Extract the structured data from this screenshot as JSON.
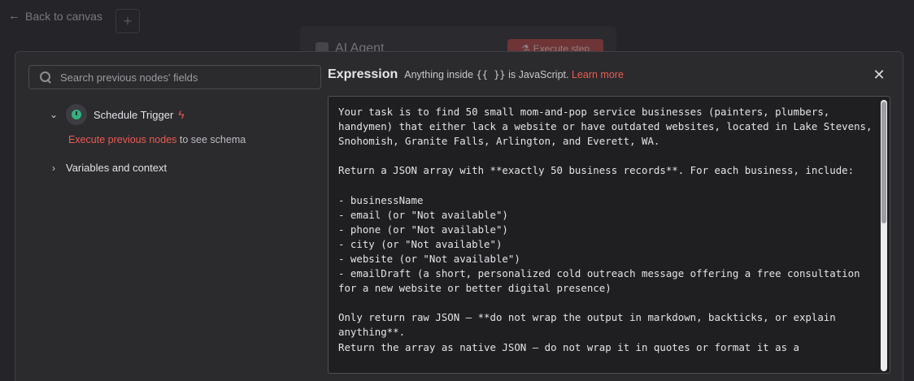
{
  "background": {
    "back_label": "Back to canvas",
    "agent_title": "AI Agent",
    "execute_step_label": "Execute step"
  },
  "search": {
    "placeholder": "Search previous nodes' fields"
  },
  "tree": {
    "node_label": "Schedule Trigger",
    "hint_link": "Execute previous nodes",
    "hint_rest": " to see schema",
    "variables_label": "Variables and context"
  },
  "expression": {
    "title": "Expression",
    "subtitle_prefix": "Anything inside",
    "subtitle_braces": "{{ }}",
    "subtitle_suffix": "is JavaScript.",
    "learn_more": "Learn more",
    "text": "Your task is to find 50 small mom-and-pop service businesses (painters, plumbers, handymen) that either lack a website or have outdated websites, located in Lake Stevens, Snohomish, Granite Falls, Arlington, and Everett, WA.\n\nReturn a JSON array with **exactly 50 business records**. For each business, include:\n\n- businessName\n- email (or \"Not available\")\n- phone (or \"Not available\")\n- city (or \"Not available\")\n- website (or \"Not available\")\n- emailDraft (a short, personalized cold outreach message offering a free consultation for a new website or better digital presence)\n\nOnly return raw JSON — **do not wrap the output in markdown, backticks, or explain anything**.\nReturn the array as native JSON — do not wrap it in quotes or format it as a"
  },
  "colors": {
    "accent": "#ee5a50",
    "trigger_icon": "#2fb37f"
  }
}
